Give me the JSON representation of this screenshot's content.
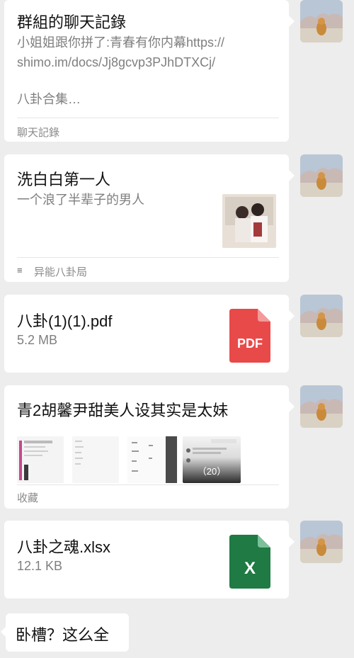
{
  "messages": [
    {
      "title": "群組的聊天記錄",
      "preview_line1": "小姐姐跟你拼了:青春有你内幕https://",
      "preview_line2": "shimo.im/docs/Jj8gcvp3PJhDTXCj/",
      "preview_line3": "八卦合集…",
      "footer": "聊天記錄"
    },
    {
      "title": "洗白白第一人",
      "description": "一个浪了半辈子的男人",
      "source": "异能八卦局"
    },
    {
      "file_name": "八卦(1)(1).pdf",
      "file_size": "5.2 MB",
      "icon_label": "PDF",
      "icon_color": "#e84a4a"
    },
    {
      "title": "青2胡馨尹甜美人设其实是太妹",
      "thumb_badge": "（20）",
      "footer": "收藏"
    },
    {
      "file_name": "八卦之魂.xlsx",
      "file_size": "12.1 KB",
      "icon_label": "X",
      "icon_color": "#1f7a44"
    }
  ],
  "reply": {
    "text": "卧槽？这么全"
  }
}
